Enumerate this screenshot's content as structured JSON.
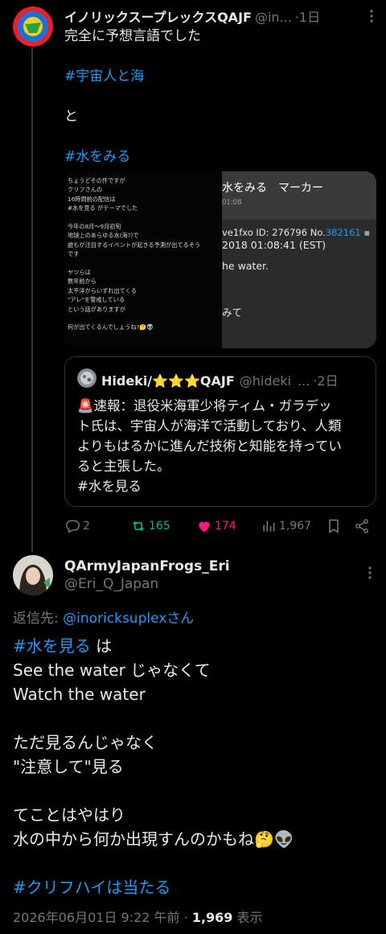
{
  "parent_tweet": {
    "name": "イノリックスープレックスQAJF",
    "handle": "@in...",
    "time": "·1日",
    "lines": [
      "完全に予想言語でした",
      "",
      "#宇宙人と海",
      "",
      "と",
      "",
      "#水をみる"
    ],
    "media": {
      "left_lines": [
        "ちょうどその件ですが",
        "クリフさんの",
        "16時間前の配信は",
        "#水を見る がテーマでした",
        "",
        "今年の8月〜9月初旬",
        "地球上のあらゆる水(海?)で",
        "誰もが注目するイベントが起きる予測が出てるそう",
        "です",
        "",
        "ヤツらは",
        "数年前から",
        "太平洋からいずれ出てくる",
        "\"アレ\"を警戒している",
        "という話がありますが",
        "",
        "何が出てくるんでしょうね?🤔👽"
      ],
      "right_title": "水をみる　マーカー",
      "right_sub": "01:08",
      "right_id_prefix": "ve1fxo  ID: 276796  No.",
      "right_id_no": "382161",
      "right_date": "2018 01:08:41 (EST)",
      "right_text1": "he water.",
      "right_text2": "みて"
    },
    "quote": {
      "name": "Hideki/⭐⭐⭐QAJF",
      "handle": "@hideki_...",
      "time": "·2日",
      "lines": [
        "🚨速報：退役米海軍少将ティム・ガラデッ",
        "ト氏は、宇宙人が海洋で活動しており、人類",
        "よりもはるかに進んだ技術と知能を持ってい",
        "ると主張した。",
        "#水を見る"
      ]
    },
    "actions": {
      "replies": "2",
      "retweets": "165",
      "likes": "174",
      "views": "1,967"
    },
    "colors": {
      "retweet": "#00ba7c",
      "like": "#f91880",
      "link": "#1d9bf0",
      "muted": "#71767b"
    }
  },
  "reply_tweet": {
    "name": "QArmyJapanFrogs_Eri",
    "handle": "@Eri_Q_Japan",
    "replying_label": "返信先: ",
    "replying_to": "@inoricksuplexさん",
    "body_hashtag": "#水を見る",
    "body_first_suffix": " は",
    "body_lines": [
      "See the water じゃなくて",
      "Watch the water",
      "",
      "ただ見るんじゃなく",
      "\"注意して\"見る",
      "",
      "てことはやはり",
      "水の中から何か出現すんのかもね🤔👽",
      ""
    ],
    "footer_hashtag": "#クリフハイは当たる",
    "timestamp": "2026年06月01日 9:22 午前 · ",
    "views_count": "1,969",
    "views_label": " 表示"
  },
  "icons": [
    "reply-icon",
    "retweet-icon",
    "like-icon",
    "views-icon",
    "bookmark-icon",
    "share-icon",
    "more-icon"
  ]
}
